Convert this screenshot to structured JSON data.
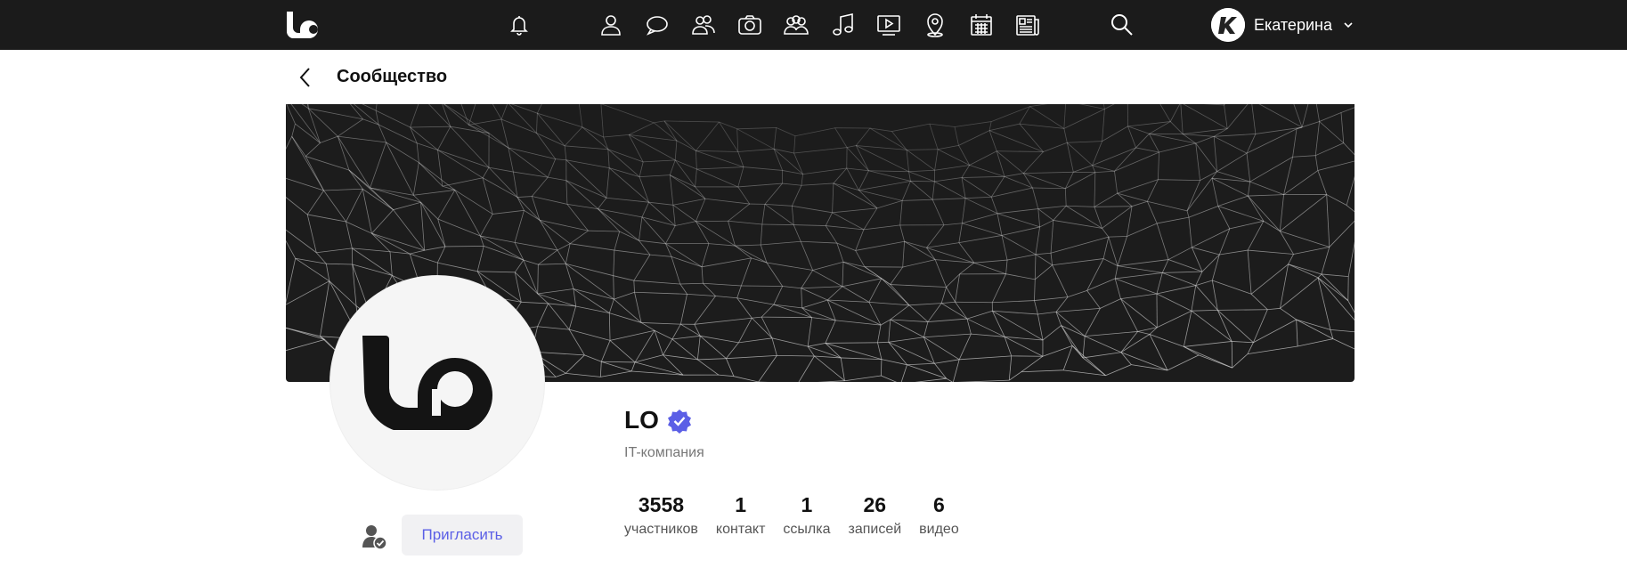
{
  "topbar": {
    "brand_icon": "lo-logo-icon",
    "nav_icons": [
      "bell-icon",
      "user-icon",
      "chat-bubble-icon",
      "friends-icon",
      "camera-icon",
      "groups-icon",
      "music-note-icon",
      "video-play-icon",
      "map-pin-icon",
      "calendar-icon",
      "news-icon"
    ],
    "search_icon": "search-icon",
    "user": {
      "name": "Екатерина",
      "avatar_icon": "avatar-icon",
      "menu_icon": "chevron-down-icon"
    }
  },
  "header": {
    "back_icon": "chevron-left-icon",
    "title": "Сообщество"
  },
  "community": {
    "name": "LO",
    "verified_icon": "verified-badge-icon",
    "category": "IT-компания",
    "stats": [
      {
        "value": "3558",
        "label": "участников"
      },
      {
        "value": "1",
        "label": "контакт"
      },
      {
        "value": "1",
        "label": "ссылка"
      },
      {
        "value": "26",
        "label": "записей"
      },
      {
        "value": "6",
        "label": "видео"
      }
    ]
  },
  "actions": {
    "member_icon": "member-check-icon",
    "invite_label": "Пригласить"
  },
  "colors": {
    "topbar": "#1b1b1b",
    "accent": "#5b5fe6",
    "cover": "#1c1c1c"
  }
}
